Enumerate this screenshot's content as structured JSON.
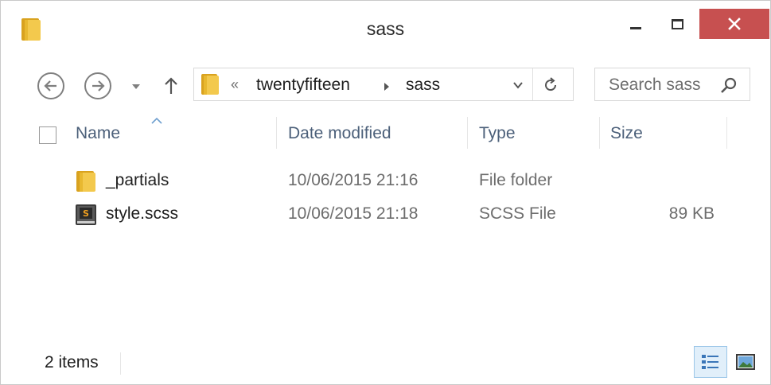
{
  "window": {
    "title": "sass",
    "accent_close": "#c75050"
  },
  "navigation": {
    "breadcrumb_overflow": "«",
    "breadcrumbs": [
      "twentyfifteen",
      "sass"
    ],
    "search_placeholder": "Search sass"
  },
  "columns": {
    "name": "Name",
    "date_modified": "Date modified",
    "type": "Type",
    "size": "Size",
    "sorted_by": "Name",
    "sort_direction": "ascending"
  },
  "files": [
    {
      "icon": "folder-icon",
      "name": "_partials",
      "date_modified": "10/06/2015 21:16",
      "type": "File folder",
      "size": ""
    },
    {
      "icon": "scss-file-icon",
      "name": "style.scss",
      "date_modified": "10/06/2015 21:18",
      "type": "SCSS File",
      "size": "89 KB"
    }
  ],
  "status": {
    "item_count": "2 items",
    "active_view": "details"
  },
  "colors": {
    "header_text": "#4c607a",
    "secondary_text": "#6d6d6d",
    "folder_yellow": "#e8b830",
    "view_selected_bg": "#e1effa"
  }
}
